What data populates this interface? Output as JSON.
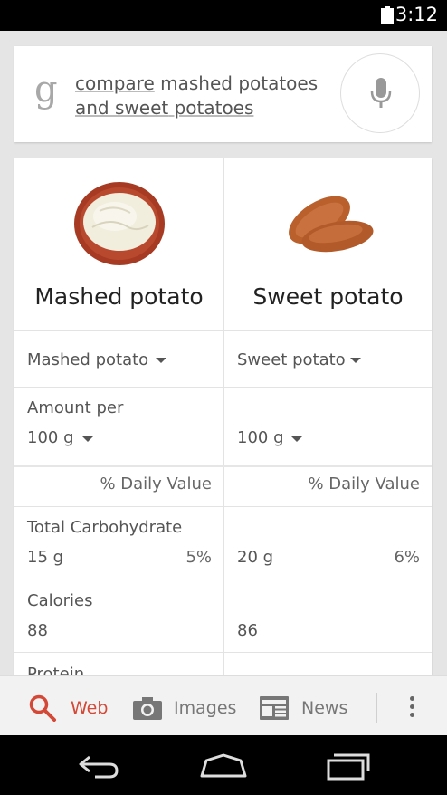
{
  "status_bar": {
    "time": "3:12",
    "battery_icon": "battery-icon"
  },
  "search": {
    "logo": "g",
    "query_line1_a": "compare",
    "query_line1_b": " mashed potatoes",
    "query_line2_a": "and sweet",
    "query_line2_b": " potatoes",
    "mic_icon": "microphone-icon"
  },
  "comparison": {
    "left": {
      "name": "Mashed potato",
      "selector": "Mashed potato",
      "amount_label": "Amount per",
      "amount": "100 g"
    },
    "right": {
      "name": "Sweet potato",
      "selector": "Sweet potato",
      "amount": "100 g"
    },
    "dv_header": "% Daily Value",
    "rows": [
      {
        "label": "Total Carbohydrate",
        "left_value": "15 g",
        "left_dv": "5%",
        "right_value": "20 g",
        "right_dv": "6%"
      },
      {
        "label": "Calories",
        "left_value": "88",
        "right_value": "86"
      },
      {
        "label": "Protein"
      }
    ]
  },
  "bottom_tabs": [
    {
      "label": "Web",
      "icon": "search-icon",
      "active": true
    },
    {
      "label": "Images",
      "icon": "camera-icon",
      "active": false
    },
    {
      "label": "News",
      "icon": "newspaper-icon",
      "active": false
    }
  ],
  "nav": {
    "back_icon": "back-icon",
    "home_icon": "home-icon",
    "recents_icon": "recent-apps-icon"
  },
  "colors": {
    "accent": "#d34836",
    "status_bar": "#000000",
    "background": "#e5e5e5"
  }
}
